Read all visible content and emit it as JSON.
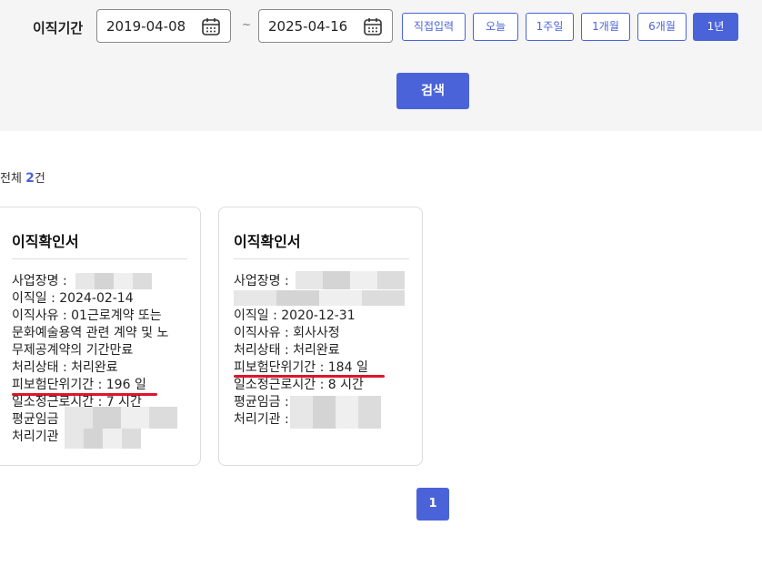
{
  "filter": {
    "period_label": "이직기간",
    "start_date": "2019-04-08",
    "separator": "~",
    "end_date": "2025-04-16",
    "range_buttons": [
      "직접입력",
      "오늘",
      "1주일",
      "1개월",
      "6개월",
      "1년"
    ],
    "active_range": "1년",
    "search_label": "검색"
  },
  "results": {
    "total_prefix": "전체 ",
    "total_count": "2",
    "total_suffix": "건"
  },
  "cards": [
    {
      "title": "이직확인서",
      "lines": [
        "사업장명 :",
        "이직일 : 2024-02-14",
        "이직사유 : 01근로계약 또는",
        "문화예술용역 관련 계약 및 노",
        "무제공계약의 기간만료",
        "처리상태 : 처리완료",
        "피보험단위기간 : 196 일",
        "일소정근로시간 : 7 시간",
        "평균임금",
        "처리기관"
      ]
    },
    {
      "title": "이직확인서",
      "lines": [
        "사업장명 :",
        "",
        "이직일 : 2020-12-31",
        "이직사유 : 회사사정",
        "처리상태 : 처리완료",
        "피보험단위기간 : 184 일",
        "일소정근로시간 : 8 시간",
        "평균임금 :",
        "처리기관 :"
      ]
    }
  ],
  "pagination": {
    "current_page": "1"
  },
  "colors": {
    "accent": "#4a63d9",
    "highlight": "#e0152a",
    "panel": "#f5f5f5"
  }
}
